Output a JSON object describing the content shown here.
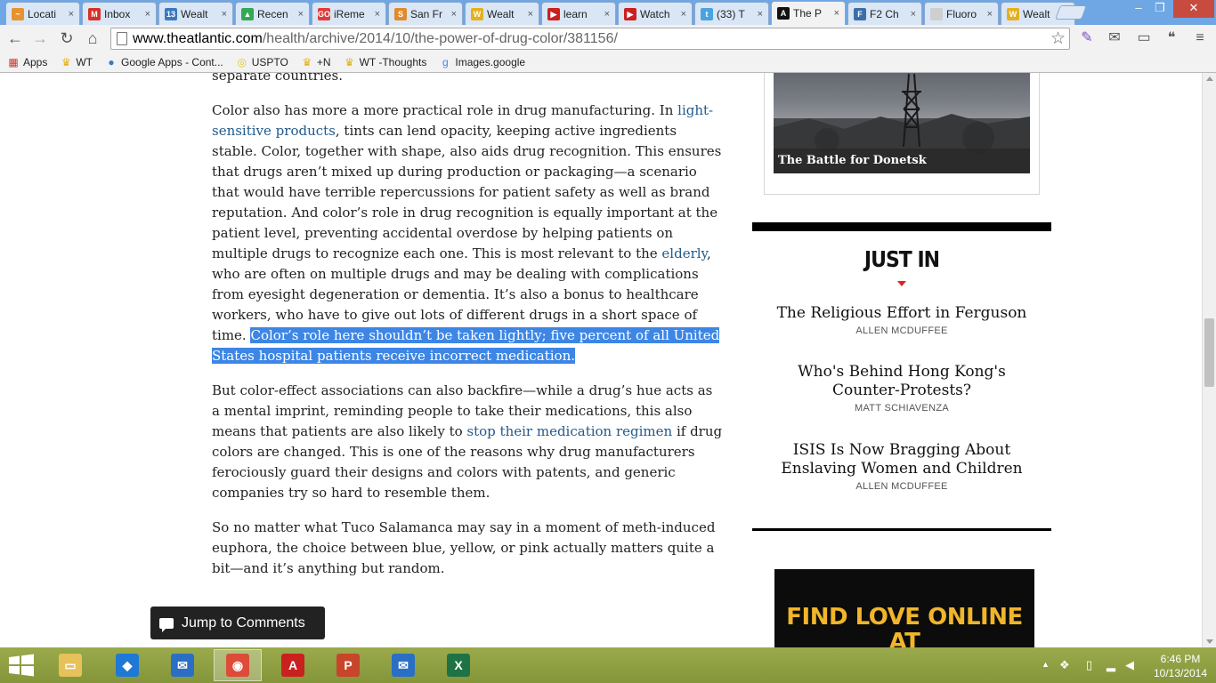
{
  "browser": {
    "tabs": [
      {
        "title": "Locati",
        "favicon_color": "#e8922d",
        "favicon_glyph": "~"
      },
      {
        "title": "Inbox",
        "favicon_color": "#d93025",
        "favicon_glyph": "M"
      },
      {
        "title": "Wealt",
        "favicon_color": "#3a78c2",
        "favicon_glyph": "13"
      },
      {
        "title": "Recen",
        "favicon_color": "#34a853",
        "favicon_glyph": "▲"
      },
      {
        "title": "iReme",
        "favicon_color": "#e23a3a",
        "favicon_glyph": "GO"
      },
      {
        "title": "San Fr",
        "favicon_color": "#e08a2c",
        "favicon_glyph": "S"
      },
      {
        "title": "Wealt",
        "favicon_color": "#e5b01c",
        "favicon_glyph": "W"
      },
      {
        "title": "learn",
        "favicon_color": "#cc1f1f",
        "favicon_glyph": "▶"
      },
      {
        "title": "Watch",
        "favicon_color": "#cc1f1f",
        "favicon_glyph": "▶"
      },
      {
        "title": "(33) T",
        "favicon_color": "#4aa3df",
        "favicon_glyph": "t"
      },
      {
        "title": "The P",
        "favicon_color": "#111111",
        "favicon_glyph": "A"
      },
      {
        "title": "F2 Ch",
        "favicon_color": "#3c6fa8",
        "favicon_glyph": "F"
      },
      {
        "title": "Fluoro",
        "favicon_color": "#cfcfcf",
        "favicon_glyph": ""
      },
      {
        "title": "Wealt",
        "favicon_color": "#e5b01c",
        "favicon_glyph": "W"
      }
    ],
    "active_tab_index": 10,
    "window_controls": {
      "minimize": "–",
      "restore": "❐",
      "close": "✕"
    },
    "url_host": "www.theatlantic.com",
    "url_path": "/health/archive/2014/10/the-power-of-drug-color/381156/",
    "bookmarks": [
      {
        "label": "Apps",
        "icon": "apps-grid-icon",
        "color": "#d93025"
      },
      {
        "label": "WT",
        "icon": "wt-crown-icon",
        "color": "#e5b01c"
      },
      {
        "label": "Google Apps - Cont...",
        "icon": "google-apps-icon",
        "color": "#3a78c2"
      },
      {
        "label": "USPTO",
        "icon": "bulb-icon",
        "color": "#e6c619"
      },
      {
        "label": "+N",
        "icon": "wt-crown-icon",
        "color": "#e5b01c"
      },
      {
        "label": "WT -Thoughts",
        "icon": "wt-crown-icon",
        "color": "#e5b01c"
      },
      {
        "label": "Images.google",
        "icon": "google-icon",
        "color": "#4285f4"
      }
    ]
  },
  "article": {
    "p0": "separate countries.",
    "p1": {
      "t1": "Color also has more a more practical role in drug manufacturing. In ",
      "link1": "light-sensitive products",
      "t2": ", tints can lend opacity, keeping active ingredients stable. Color, together with shape, also aids drug recognition. This ensures that drugs aren’t mixed up during production or packaging—a scenario that would have terrible repercussions for patient safety as well as brand reputation. And color’s role in drug recognition is equally important at the patient level, preventing accidental overdose by helping patients on multiple drugs to recognize each one. This is most relevant to the ",
      "link2": "elderly",
      "t3": ", who are often on multiple drugs and may be dealing with complications from eyesight degeneration or dementia. It’s also a bonus to healthcare workers, who have to give out lots of different drugs in a short space of time. ",
      "highlight": "Color’s role here shouldn’t be taken lightly; five percent of all United States hospital patients receive incorrect medication."
    },
    "p2": {
      "t1": "But color-effect associations can also backfire—while a drug’s hue acts as a mental imprint, reminding people to take their medications, this also means that patients are also likely to ",
      "link": "stop their medication regimen",
      "t2": " if drug colors are changed. This is one of the reasons why drug manufacturers ferociously guard their designs and colors with patents, and generic companies try so hard to resemble them."
    },
    "p3": "So no matter what Tuco Salamanca may say in a moment of meth-induced euphora, the choice between blue, yellow, or pink actually matters quite a bit—and it’s anything but random.",
    "jump_label": "Jump to Comments"
  },
  "sidebar": {
    "gallery_caption": "The Battle for Donetsk",
    "just_in_title": "JUST IN",
    "stories": [
      {
        "title": "The Religious Effort in Ferguson",
        "author": "ALLEN MCDUFFEE"
      },
      {
        "title": "Who's Behind Hong Kong's Counter-Protests?",
        "author": "MATT SCHIAVENZA"
      },
      {
        "title": "ISIS Is Now Bragging About Enslaving Women and Children",
        "author": "ALLEN MCDUFFEE"
      }
    ],
    "ad_text": "FIND LOVE ONLINE AT"
  },
  "taskbar": {
    "apps": [
      {
        "name": "file-explorer",
        "color": "#e7c25a",
        "glyph": "▭"
      },
      {
        "name": "dropbox",
        "color": "#1e79d6",
        "glyph": "◆"
      },
      {
        "name": "outlook-express",
        "color": "#2a6fc4",
        "glyph": "✉"
      },
      {
        "name": "chrome",
        "color": "#dd4b39",
        "glyph": "◉"
      },
      {
        "name": "acrobat",
        "color": "#c9211e",
        "glyph": "A"
      },
      {
        "name": "powerpoint",
        "color": "#c8442a",
        "glyph": "P"
      },
      {
        "name": "mail",
        "color": "#2a6fc4",
        "glyph": "✉"
      },
      {
        "name": "excel",
        "color": "#1f7244",
        "glyph": "X"
      }
    ],
    "active_app_index": 3,
    "time": "6:46 PM",
    "date": "10/13/2014"
  }
}
